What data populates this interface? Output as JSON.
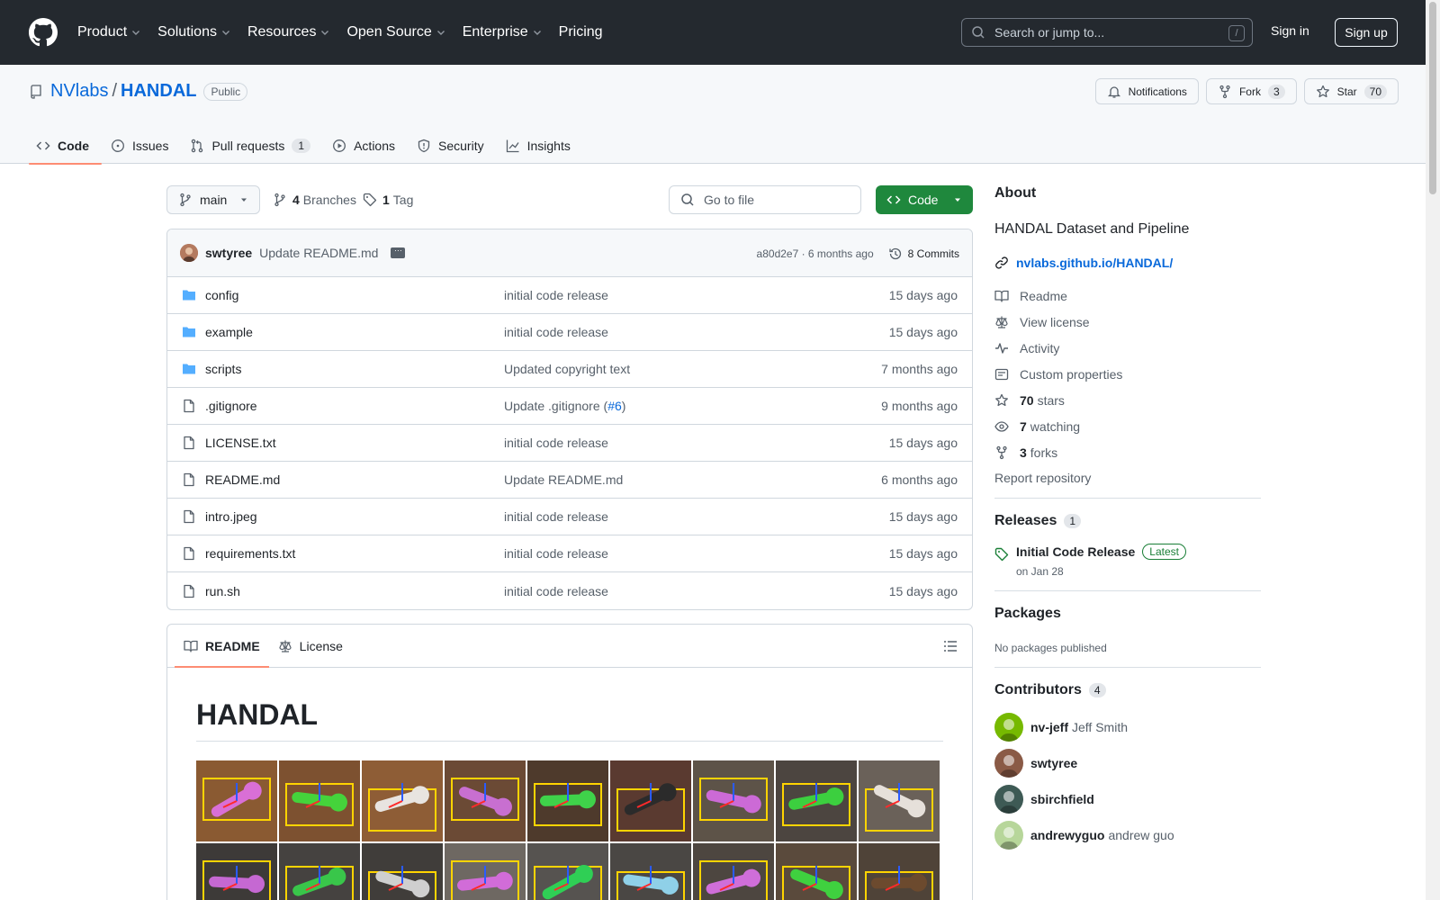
{
  "header": {
    "nav": [
      "Product",
      "Solutions",
      "Resources",
      "Open Source",
      "Enterprise",
      "Pricing"
    ],
    "search_placeholder": "Search or jump to...",
    "search_shortcut": "/",
    "sign_in": "Sign in",
    "sign_up": "Sign up"
  },
  "repo": {
    "owner": "NVlabs",
    "separator": "/",
    "name": "HANDAL",
    "visibility": "Public",
    "notifications_label": "Notifications",
    "fork_label": "Fork",
    "fork_count": "3",
    "star_label": "Star",
    "star_count": "70",
    "tabs": [
      {
        "label": "Code",
        "icon": "code-icon"
      },
      {
        "label": "Issues",
        "icon": "issue-icon"
      },
      {
        "label": "Pull requests",
        "icon": "pull-request-icon",
        "count": "1"
      },
      {
        "label": "Actions",
        "icon": "play-icon"
      },
      {
        "label": "Security",
        "icon": "shield-icon"
      },
      {
        "label": "Insights",
        "icon": "graph-icon"
      }
    ]
  },
  "file_nav": {
    "branch": "main",
    "branches_count": "4",
    "branches_label": "Branches",
    "tags_count": "1",
    "tags_label": "Tag",
    "go_to_file": "Go to file",
    "code_button": "Code"
  },
  "latest_commit": {
    "author": "swtyree",
    "message": "Update README.md",
    "hash_time": "a80d2e7 · 6 months ago",
    "commits_label": "8 Commits"
  },
  "files": [
    {
      "name": "config",
      "type": "folder",
      "message": "initial code release",
      "time": "15 days ago"
    },
    {
      "name": "example",
      "type": "folder",
      "message": "initial code release",
      "time": "15 days ago"
    },
    {
      "name": "scripts",
      "type": "folder",
      "message": "Updated copyright text",
      "time": "7 months ago"
    },
    {
      "name": ".gitignore",
      "type": "file",
      "message": "Update .gitignore (",
      "pr": "#6",
      "message_end": ")",
      "time": "9 months ago"
    },
    {
      "name": "LICENSE.txt",
      "type": "file",
      "message": "initial code release",
      "time": "15 days ago"
    },
    {
      "name": "README.md",
      "type": "file",
      "message": "Update README.md",
      "time": "6 months ago"
    },
    {
      "name": "intro.jpeg",
      "type": "file",
      "message": "initial code release",
      "time": "15 days ago"
    },
    {
      "name": "requirements.txt",
      "type": "file",
      "message": "initial code release",
      "time": "15 days ago"
    },
    {
      "name": "run.sh",
      "type": "file",
      "message": "initial code release",
      "time": "15 days ago"
    }
  ],
  "readme": {
    "tab_readme": "README",
    "tab_license": "License",
    "heading": "HANDAL",
    "tiles": [
      {
        "bg": "#8a5a32",
        "obj": "#d96fd6"
      },
      {
        "bg": "#7d5130",
        "obj": "#45d33b"
      },
      {
        "bg": "#8e5d36",
        "obj": "#e8e4e0"
      },
      {
        "bg": "#6b4a35",
        "obj": "#c86fd0"
      },
      {
        "bg": "#4e3a2c",
        "obj": "#3fd24a"
      },
      {
        "bg": "#5a3a30",
        "obj": "#2b2b2b"
      },
      {
        "bg": "#5d5348",
        "obj": "#cc6ad6"
      },
      {
        "bg": "#4c4540",
        "obj": "#3ccf3f"
      },
      {
        "bg": "#6a6159",
        "obj": "#e6e0da"
      },
      {
        "bg": "#3d3a38",
        "obj": "#c568d2"
      },
      {
        "bg": "#454240",
        "obj": "#39c64a"
      },
      {
        "bg": "#403d3a",
        "obj": "#cfcfcf"
      },
      {
        "bg": "#6e6862",
        "obj": "#d16cd8"
      },
      {
        "bg": "#565350",
        "obj": "#2fcf55"
      },
      {
        "bg": "#4a4744",
        "obj": "#8fd0e8"
      },
      {
        "bg": "#4d4640",
        "obj": "#cf6ed9"
      },
      {
        "bg": "#5a4a3c",
        "obj": "#3fd13f"
      },
      {
        "bg": "#4f4338",
        "obj": "#6c4a2e"
      }
    ]
  },
  "about": {
    "title": "About",
    "description": "HANDAL Dataset and Pipeline",
    "link": "nvlabs.github.io/HANDAL/",
    "items": [
      {
        "icon": "book-icon",
        "label": "Readme"
      },
      {
        "icon": "law-icon",
        "label": "View license"
      },
      {
        "icon": "pulse-icon",
        "label": "Activity"
      },
      {
        "icon": "note-icon",
        "label": "Custom properties"
      },
      {
        "icon": "star-icon",
        "count": "70",
        "label": "stars"
      },
      {
        "icon": "eye-icon",
        "count": "7",
        "label": "watching"
      },
      {
        "icon": "fork-icon",
        "count": "3",
        "label": "forks"
      }
    ],
    "report": "Report repository"
  },
  "releases": {
    "title": "Releases",
    "count": "1",
    "name": "Initial Code Release",
    "badge": "Latest",
    "date": "on Jan 28"
  },
  "packages": {
    "title": "Packages",
    "empty": "No packages published"
  },
  "contributors": {
    "title": "Contributors",
    "count": "4",
    "list": [
      {
        "login": "nv-jeff",
        "name": "Jeff Smith",
        "color": "#76b900"
      },
      {
        "login": "swtyree",
        "name": "",
        "color": "#8a5a46"
      },
      {
        "login": "sbirchfield",
        "name": "",
        "color": "#3e5a55"
      },
      {
        "login": "andrewyguo",
        "name": "andrew guo",
        "color": "#b7d69a"
      }
    ]
  }
}
